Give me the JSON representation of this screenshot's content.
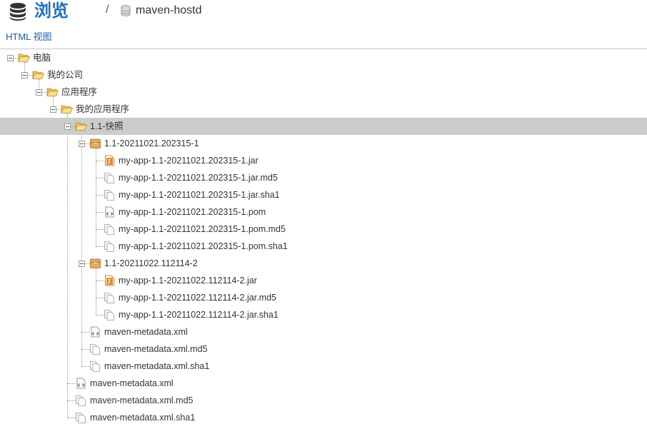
{
  "header": {
    "title": "浏览",
    "separator": "/",
    "repository": "maven-hostd"
  },
  "html_view_link": "HTML 视图",
  "tree": [
    {
      "depth": 0,
      "label": "电脑",
      "icon": "folder-open-icon",
      "toggle": true
    },
    {
      "depth": 1,
      "label": "我的公司",
      "icon": "folder-open-icon",
      "toggle": true
    },
    {
      "depth": 2,
      "label": "应用程序",
      "icon": "folder-open-icon",
      "toggle": true
    },
    {
      "depth": 3,
      "label": "我的应用程序",
      "icon": "folder-open-icon",
      "toggle": true
    },
    {
      "depth": 4,
      "label": "1.1-快照",
      "icon": "folder-open-icon",
      "toggle": true,
      "selected": true
    },
    {
      "depth": 5,
      "label": "1.1-20211021.202315-1",
      "icon": "package-icon",
      "toggle": true
    },
    {
      "depth": 6,
      "label": "my-app-1.1-20211021.202315-1.jar",
      "icon": "jar-file-icon"
    },
    {
      "depth": 6,
      "label": "my-app-1.1-20211021.202315-1.jar.md5",
      "icon": "generic-file-icon"
    },
    {
      "depth": 6,
      "label": "my-app-1.1-20211021.202315-1.jar.sha1",
      "icon": "generic-file-icon"
    },
    {
      "depth": 6,
      "label": "my-app-1.1-20211021.202315-1.pom",
      "icon": "xml-file-icon"
    },
    {
      "depth": 6,
      "label": "my-app-1.1-20211021.202315-1.pom.md5",
      "icon": "generic-file-icon"
    },
    {
      "depth": 6,
      "label": "my-app-1.1-20211021.202315-1.pom.sha1",
      "icon": "generic-file-icon"
    },
    {
      "depth": 5,
      "label": "1.1-20211022.112114-2",
      "icon": "package-icon",
      "toggle": true
    },
    {
      "depth": 6,
      "label": "my-app-1.1-20211022.112114-2.jar",
      "icon": "jar-file-icon"
    },
    {
      "depth": 6,
      "label": "my-app-1.1-20211022.112114-2.jar.md5",
      "icon": "generic-file-icon"
    },
    {
      "depth": 6,
      "label": "my-app-1.1-20211022.112114-2.jar.sha1",
      "icon": "generic-file-icon"
    },
    {
      "depth": 5,
      "label": "maven-metadata.xml",
      "icon": "xml-file-icon"
    },
    {
      "depth": 5,
      "label": "maven-metadata.xml.md5",
      "icon": "generic-file-icon"
    },
    {
      "depth": 5,
      "label": "maven-metadata.xml.sha1",
      "icon": "generic-file-icon"
    },
    {
      "depth": 4,
      "label": "maven-metadata.xml",
      "icon": "xml-file-icon"
    },
    {
      "depth": 4,
      "label": "maven-metadata.xml.md5",
      "icon": "generic-file-icon"
    },
    {
      "depth": 4,
      "label": "maven-metadata.xml.sha1",
      "icon": "generic-file-icon"
    }
  ],
  "colors": {
    "title": "#1e6fc0",
    "link": "#1a5fa8",
    "selected_row": "#cccccc",
    "folder": "#f6d27a",
    "package": "#e0a964",
    "jar": "#e8842c"
  }
}
